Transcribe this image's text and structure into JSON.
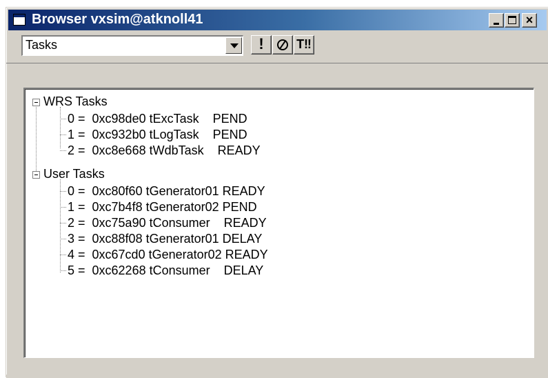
{
  "window": {
    "title": "Browser vxsim@atknoll41",
    "minimize_label": "_",
    "maximize_label": "",
    "close_label": "×"
  },
  "toolbar": {
    "view_select_value": "Tasks",
    "bang_label": "!",
    "config_label": "T‼"
  },
  "tree": {
    "groups": [
      {
        "label": "WRS Tasks",
        "items": [
          "0 =  0xc98de0 tExcTask    PEND",
          "1 =  0xc932b0 tLogTask    PEND",
          "2 =  0xc8e668 tWdbTask    READY"
        ]
      },
      {
        "label": "User Tasks",
        "items": [
          "0 =  0xc80f60 tGenerator01 READY",
          "1 =  0xc7b4f8 tGenerator02 PEND",
          "2 =  0xc75a90 tConsumer    READY",
          "3 =  0xc88f08 tGenerator01 DELAY",
          "4 =  0xc67cd0 tGenerator02 READY",
          "5 =  0xc62268 tConsumer    DELAY"
        ]
      }
    ]
  },
  "icons": {
    "window_icon": "window-icon",
    "watch_icon": "watch-icon",
    "config_icon": "config-icon",
    "dropdown_icon": "chevron-down-icon"
  },
  "colors": {
    "titlebar_start": "#0a246a",
    "titlebar_end": "#a6caf0",
    "face": "#d4d0c8"
  }
}
